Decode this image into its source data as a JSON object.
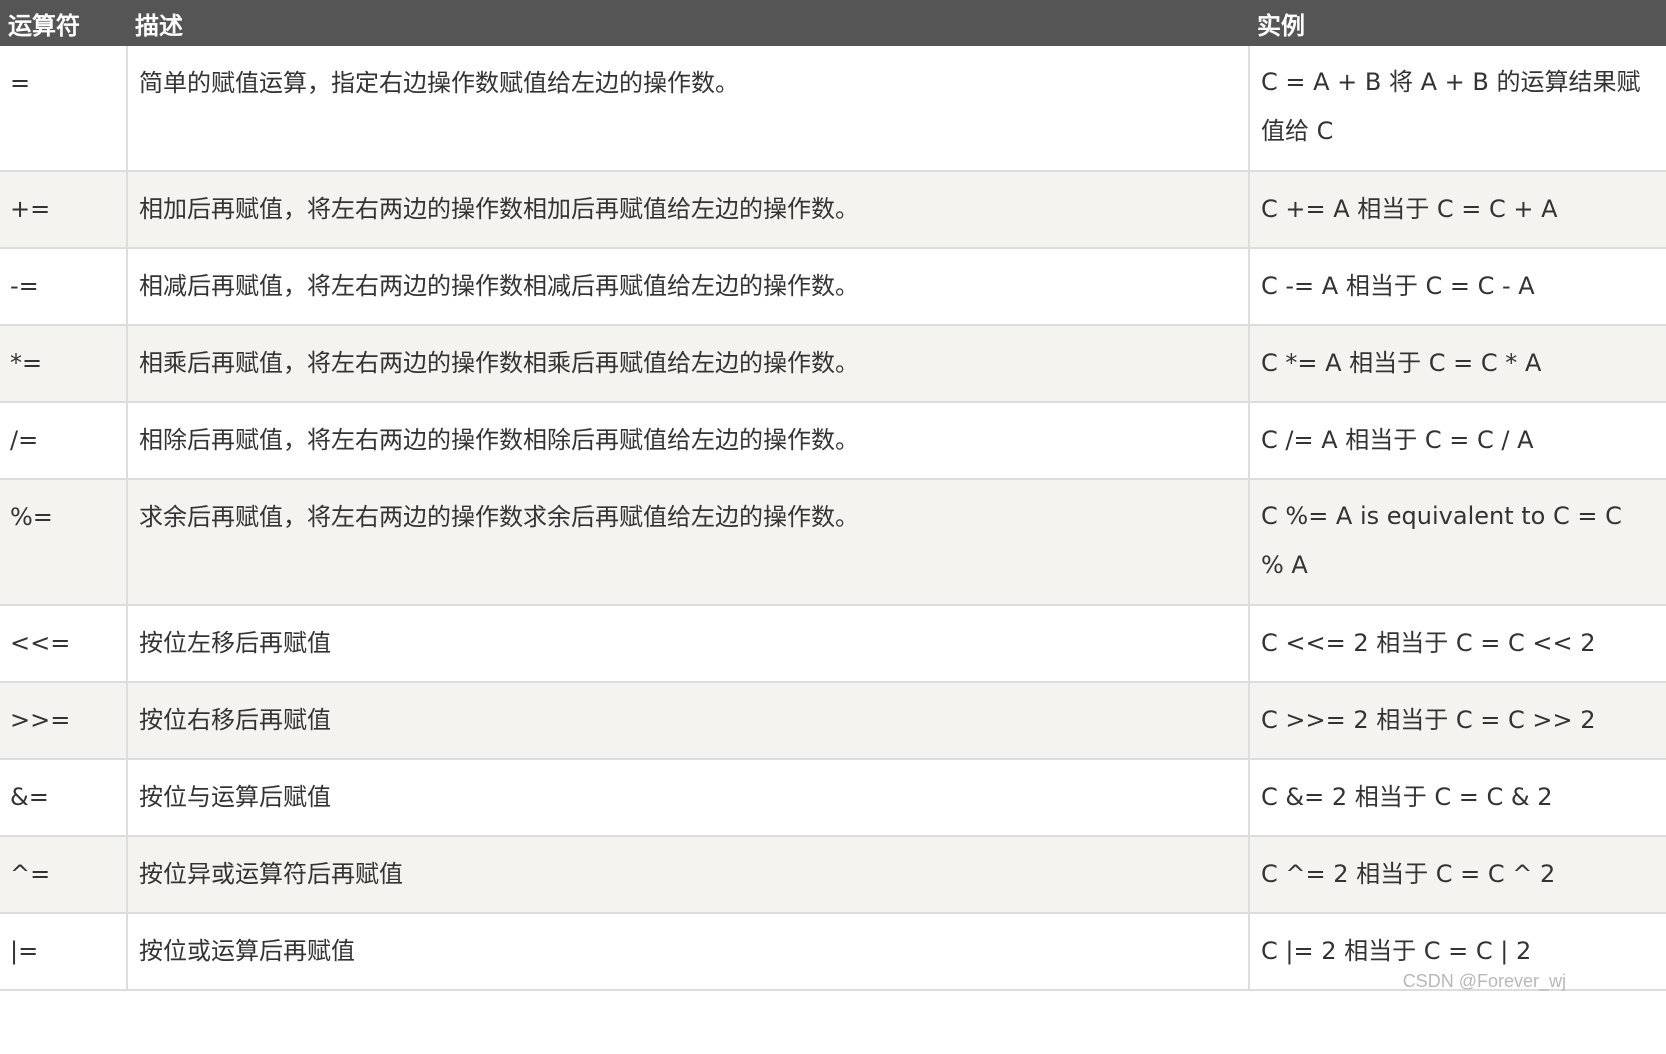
{
  "table": {
    "headers": {
      "operator": "运算符",
      "description": "描述",
      "example": "实例"
    },
    "rows": [
      {
        "op": "=",
        "desc": "简单的赋值运算，指定右边操作数赋值给左边的操作数。",
        "ex": "C = A + B 将 A + B 的运算结果赋值给 C"
      },
      {
        "op": "+=",
        "desc": "相加后再赋值，将左右两边的操作数相加后再赋值给左边的操作数。",
        "ex": "C += A 相当于 C = C + A"
      },
      {
        "op": "-=",
        "desc": "相减后再赋值，将左右两边的操作数相减后再赋值给左边的操作数。",
        "ex": "C -= A 相当于 C = C - A"
      },
      {
        "op": "*=",
        "desc": "相乘后再赋值，将左右两边的操作数相乘后再赋值给左边的操作数。",
        "ex": "C *= A 相当于 C = C * A"
      },
      {
        "op": "/=",
        "desc": "相除后再赋值，将左右两边的操作数相除后再赋值给左边的操作数。",
        "ex": "C /= A 相当于 C = C / A"
      },
      {
        "op": "%=",
        "desc": "求余后再赋值，将左右两边的操作数求余后再赋值给左边的操作数。",
        "ex": "C %= A is equivalent to C = C % A"
      },
      {
        "op": "<<=",
        "desc": "按位左移后再赋值",
        "ex": "C <<= 2 相当于 C = C << 2"
      },
      {
        "op": ">>=",
        "desc": "按位右移后再赋值",
        "ex": "C >>= 2 相当于 C = C >> 2"
      },
      {
        "op": "&=",
        "desc": "按位与运算后赋值",
        "ex": "C &= 2 相当于 C = C & 2"
      },
      {
        "op": "^=",
        "desc": "按位异或运算符后再赋值",
        "ex": "C ^= 2 相当于 C = C ^ 2"
      },
      {
        "op": "|=",
        "desc": "按位或运算后再赋值",
        "ex": "C |= 2 相当于 C = C | 2"
      }
    ]
  },
  "watermark": "CSDN @Forever_wj",
  "colors": {
    "header_bg": "#555555",
    "row_alt_bg": "#f4f3f0",
    "border": "#dddddd"
  }
}
